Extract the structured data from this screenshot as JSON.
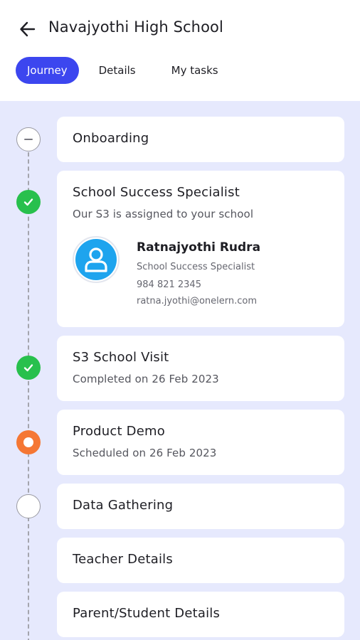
{
  "header": {
    "title": "Navajyothi High School",
    "back_icon": "arrow-left-icon"
  },
  "tabs": [
    {
      "label": "Journey",
      "active": true
    },
    {
      "label": "Details",
      "active": false
    },
    {
      "label": "My tasks",
      "active": false
    }
  ],
  "colors": {
    "accent": "#3c46ef",
    "done": "#28c04d",
    "current": "#f57734",
    "background": "#e6e9fd"
  },
  "steps": [
    {
      "title": "Onboarding",
      "status": "collapsed"
    },
    {
      "title": "School Success Specialist",
      "subtitle": "Our S3 is assigned to your school",
      "status": "done",
      "contact": {
        "name": "Ratnajyothi Rudra",
        "role": "School Success Specialist",
        "phone": "984 821 2345",
        "email": "ratna.jyothi@onelern.com",
        "icon": "user-avatar-icon"
      }
    },
    {
      "title": "S3 School Visit",
      "subtitle": "Completed on 26 Feb 2023",
      "status": "done"
    },
    {
      "title": "Product Demo",
      "subtitle": "Scheduled on 26 Feb 2023",
      "status": "current"
    },
    {
      "title": "Data Gathering",
      "status": "pending"
    },
    {
      "title": "Teacher Details",
      "status": "pending"
    },
    {
      "title": "Parent/Student Details",
      "status": "pending"
    }
  ]
}
